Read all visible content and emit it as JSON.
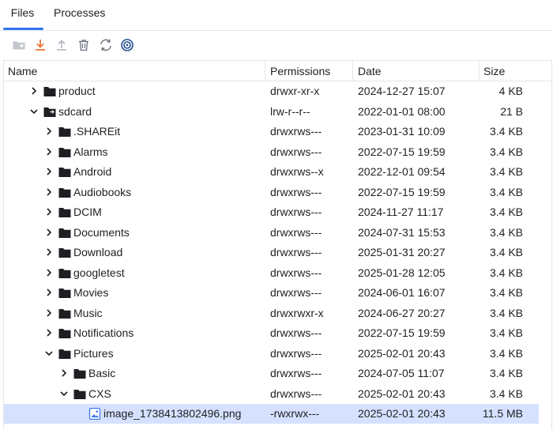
{
  "tabs": [
    {
      "label": "Files",
      "active": true
    },
    {
      "label": "Processes",
      "active": false
    }
  ],
  "toolbar": {
    "icons": [
      "new-folder-icon",
      "download-icon",
      "upload-icon",
      "delete-icon",
      "refresh-icon",
      "target-icon"
    ]
  },
  "columns": {
    "name": "Name",
    "permissions": "Permissions",
    "date": "Date",
    "size": "Size"
  },
  "rows": [
    {
      "depth": 0,
      "chevron": "right",
      "icon": "folder",
      "name": "product",
      "permissions": "drwxr-xr-x",
      "date": "2024-12-27 15:07",
      "size": "4 KB"
    },
    {
      "depth": 0,
      "chevron": "down",
      "icon": "folder-link",
      "name": "sdcard",
      "permissions": "lrw-r--r--",
      "date": "2022-01-01 08:00",
      "size": "21 B"
    },
    {
      "depth": 1,
      "chevron": "right",
      "icon": "folder",
      "name": ".SHAREit",
      "permissions": "drwxrws---",
      "date": "2023-01-31 10:09",
      "size": "3.4 KB"
    },
    {
      "depth": 1,
      "chevron": "right",
      "icon": "folder",
      "name": "Alarms",
      "permissions": "drwxrws---",
      "date": "2022-07-15 19:59",
      "size": "3.4 KB"
    },
    {
      "depth": 1,
      "chevron": "right",
      "icon": "folder",
      "name": "Android",
      "permissions": "drwxrws--x",
      "date": "2022-12-01 09:54",
      "size": "3.4 KB"
    },
    {
      "depth": 1,
      "chevron": "right",
      "icon": "folder",
      "name": "Audiobooks",
      "permissions": "drwxrws---",
      "date": "2022-07-15 19:59",
      "size": "3.4 KB"
    },
    {
      "depth": 1,
      "chevron": "right",
      "icon": "folder",
      "name": "DCIM",
      "permissions": "drwxrws---",
      "date": "2024-11-27 11:17",
      "size": "3.4 KB"
    },
    {
      "depth": 1,
      "chevron": "right",
      "icon": "folder",
      "name": "Documents",
      "permissions": "drwxrws---",
      "date": "2024-07-31 15:53",
      "size": "3.4 KB"
    },
    {
      "depth": 1,
      "chevron": "right",
      "icon": "folder",
      "name": "Download",
      "permissions": "drwxrws---",
      "date": "2025-01-31 20:27",
      "size": "3.4 KB"
    },
    {
      "depth": 1,
      "chevron": "right",
      "icon": "folder",
      "name": "googletest",
      "permissions": "drwxrws---",
      "date": "2025-01-28 12:05",
      "size": "3.4 KB"
    },
    {
      "depth": 1,
      "chevron": "right",
      "icon": "folder",
      "name": "Movies",
      "permissions": "drwxrws---",
      "date": "2024-06-01 16:07",
      "size": "3.4 KB"
    },
    {
      "depth": 1,
      "chevron": "right",
      "icon": "folder",
      "name": "Music",
      "permissions": "drwxrwxr-x",
      "date": "2024-06-27 20:27",
      "size": "3.4 KB"
    },
    {
      "depth": 1,
      "chevron": "right",
      "icon": "folder",
      "name": "Notifications",
      "permissions": "drwxrws---",
      "date": "2022-07-15 19:59",
      "size": "3.4 KB"
    },
    {
      "depth": 1,
      "chevron": "down",
      "icon": "folder",
      "name": "Pictures",
      "permissions": "drwxrws---",
      "date": "2025-02-01 20:43",
      "size": "3.4 KB"
    },
    {
      "depth": 2,
      "chevron": "right",
      "icon": "folder",
      "name": "Basic",
      "permissions": "drwxrws---",
      "date": "2024-07-05 11:07",
      "size": "3.4 KB"
    },
    {
      "depth": 2,
      "chevron": "down",
      "icon": "folder",
      "name": "CXS",
      "permissions": "drwxrws---",
      "date": "2025-02-01 20:43",
      "size": "3.4 KB"
    },
    {
      "depth": 3,
      "chevron": "none",
      "icon": "image-file",
      "name": "image_1738413802496.png",
      "permissions": "-rwxrwx---",
      "date": "2025-02-01 20:43",
      "size": "11.5 MB",
      "selected": true
    }
  ],
  "colors": {
    "accent": "#3574f0",
    "selection": "#d5e1ff",
    "download": "#e8743b",
    "disabled": "#b4b8bf",
    "text": "#1e1f22"
  }
}
